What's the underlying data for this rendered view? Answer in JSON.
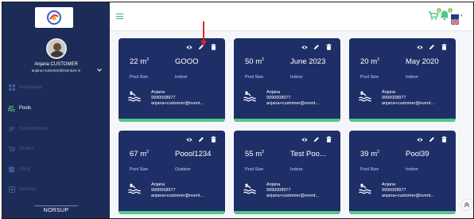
{
  "sidebar": {
    "user_name": "Anjana CUSTOMER",
    "user_email": "anjana+customer@nventure.in",
    "footer": "NORSUP",
    "nav": [
      {
        "label": "Dashboard",
        "icon": "dashboard-icon",
        "active": false
      },
      {
        "label": "Pools",
        "icon": "pool-icon",
        "active": true
      },
      {
        "label": "Subscriptions",
        "icon": "subscription-icon",
        "active": false
      },
      {
        "label": "Orders",
        "icon": "cart-icon",
        "active": false
      },
      {
        "label": "Shop",
        "icon": "shop-icon",
        "active": false
      },
      {
        "label": "Devices",
        "icon": "device-icon",
        "active": false
      }
    ]
  },
  "topbar": {
    "icons": [
      "cart-icon",
      "notification-icon",
      "language-flag-icon"
    ],
    "badge_1": "0",
    "badge_2": "0"
  },
  "pools": [
    {
      "size_value": "22 m",
      "size_exp": "3",
      "name": "GOOO",
      "size_label": "Pool Size",
      "type": "Indoor",
      "owner_name": "Anjana",
      "owner_phone": "9990008977",
      "owner_email": "anjana+customer@nvent..."
    },
    {
      "size_value": "50 m",
      "size_exp": "3",
      "name": "June 2023",
      "size_label": "Pool Size",
      "type": "Indoor",
      "owner_name": "Anjana",
      "owner_phone": "9990008977",
      "owner_email": "anjana+customer@nvent..."
    },
    {
      "size_value": "20 m",
      "size_exp": "3",
      "name": "May 2020",
      "size_label": "Pool Size",
      "type": "Indoor",
      "owner_name": "Anjana",
      "owner_phone": "9990008977",
      "owner_email": "anjana+customer@nvent..."
    },
    {
      "size_value": "67 m",
      "size_exp": "3",
      "name": "Poool1234",
      "size_label": "Pool Size",
      "type": "Outdoor",
      "owner_name": "Anjana",
      "owner_phone": "9990008977",
      "owner_email": "anjana+customer@nvent..."
    },
    {
      "size_value": "55 m",
      "size_exp": "3",
      "name": "Test Poo...",
      "size_label": "Pool Size",
      "type": "Indoor",
      "owner_name": "Anjana",
      "owner_phone": "9990008977",
      "owner_email": "anjana+customer@nvent..."
    },
    {
      "size_value": "39 m",
      "size_exp": "3",
      "name": "Pool39",
      "size_label": "Pool Size",
      "type": "Indoor",
      "owner_name": "Anjana",
      "owner_phone": "9990008977",
      "owner_email": "anjana+customer@nvent..."
    }
  ],
  "colors": {
    "sidebar_bg": "#1c2b57",
    "card_bg": "#1e2f68",
    "accent_green": "#52c78a",
    "annotation_red": "#e02424"
  }
}
